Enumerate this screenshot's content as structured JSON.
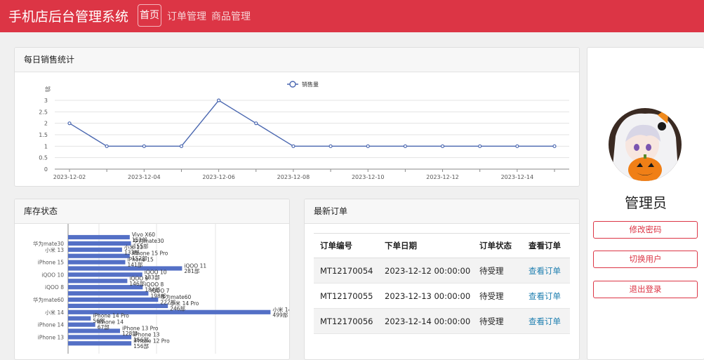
{
  "app": {
    "title": "手机店后台管理系统",
    "nav": [
      {
        "label": "首页",
        "active": true
      },
      {
        "label": "订单管理",
        "active": false
      },
      {
        "label": "商品管理",
        "active": false
      }
    ],
    "accent_color": "#dc3545"
  },
  "sales_panel": {
    "title": "每日销售统计",
    "chart_data": {
      "type": "line",
      "ylabel": "部",
      "ylim": [
        0,
        3
      ],
      "yticks": [
        0,
        0.5,
        1,
        1.5,
        2,
        2.5,
        3
      ],
      "x": [
        "2023-12-02",
        "2023-12-03",
        "2023-12-04",
        "2023-12-05",
        "2023-12-06",
        "2023-12-07",
        "2023-12-08",
        "2023-12-09",
        "2023-12-10",
        "2023-12-11",
        "2023-12-12",
        "2023-12-13",
        "2023-12-14",
        "2023-12-15"
      ],
      "xtick_labels": [
        "2023-12-02",
        "2023-12-04",
        "2023-12-06",
        "2023-12-08",
        "2023-12-10",
        "2023-12-12",
        "2023-12-14"
      ],
      "series": [
        {
          "name": "销售量",
          "values": [
            2,
            1,
            1,
            1,
            3,
            2,
            1,
            1,
            1,
            1,
            1,
            1,
            1,
            1
          ],
          "color": "#4a67b0"
        }
      ],
      "legend_position": "top-center",
      "grid": true
    }
  },
  "stock_panel": {
    "title": "库存状态",
    "chart_data": {
      "type": "bar",
      "orientation": "horizontal",
      "axis_labels": [
        "华为mate30",
        "小米 13",
        "iPhone 15",
        "iQOO 10",
        "iQOO 8",
        "华为mate60",
        "小米 14",
        "iPhone 14",
        "iPhone 13"
      ],
      "categories": [
        "Vivo X60",
        "华为mate30",
        "小米 13",
        "iPhone 15 Pro",
        "iPhone 15",
        "iQOO 11",
        "iQOO 10",
        "iQOO 9",
        "iQOO 8",
        "iQOO 7",
        "华为mate60",
        "小米 14 Pro",
        "小米 14",
        "iPhone 14 Pro",
        "iPhone 14",
        "iPhone 13 Pro",
        "iPhone 13",
        "iPhone 12 Pro"
      ],
      "values": [
        152,
        155,
        133,
        152,
        141,
        281,
        183,
        146,
        184,
        198,
        222,
        246,
        499,
        56,
        67,
        128,
        156,
        156
      ],
      "data_labels": [
        {
          "name": "Vivo X60",
          "value": "152部"
        },
        {
          "name": "华为mate30",
          "value": "155部"
        },
        {
          "name": "小米 13",
          "value": "133部"
        },
        {
          "name": "iPhone 15 Pro",
          "value": "152部"
        },
        {
          "name": "iPhone 15",
          "value": "141部"
        },
        {
          "name": "iQOO 11",
          "value": "281部"
        },
        {
          "name": "iQOO 10",
          "value": "183部"
        },
        {
          "name": "iQOO 9",
          "value": "146部"
        },
        {
          "name": "iQOO 8",
          "value": "184部"
        },
        {
          "name": "iQOO 7",
          "value": "198部"
        },
        {
          "name": "华为mate60",
          "value": "222部"
        },
        {
          "name": "小米 14 Pro",
          "value": "246部"
        },
        {
          "name": "小米 14",
          "value": "499部"
        },
        {
          "name": "iPhone 14 Pro",
          "value": "56部"
        },
        {
          "name": "iPhone 14",
          "value": "67部"
        },
        {
          "name": "iPhone 13 Pro",
          "value": "128部"
        },
        {
          "name": "iPhone 13",
          "value": "156部"
        },
        {
          "name": "iPhone 12 Pro",
          "value": "156部"
        }
      ],
      "bar_color": "#5470c6"
    }
  },
  "orders_panel": {
    "title": "最新订单",
    "columns": [
      "订单编号",
      "下单日期",
      "订单状态",
      "查看订单"
    ],
    "rows": [
      {
        "id": "MT12170054",
        "date": "2023-12-12 00:00:00",
        "status": "待受理",
        "action": "查看订单"
      },
      {
        "id": "MT12170055",
        "date": "2023-12-13 00:00:00",
        "status": "待受理",
        "action": "查看订单"
      },
      {
        "id": "MT12170056",
        "date": "2023-12-14 00:00:00",
        "status": "待受理",
        "action": "查看订单"
      }
    ]
  },
  "profile": {
    "avatar_icon": "anime-avatar-pumpkin",
    "username": "管理员",
    "buttons": [
      "修改密码",
      "切换用户",
      "退出登录"
    ]
  }
}
